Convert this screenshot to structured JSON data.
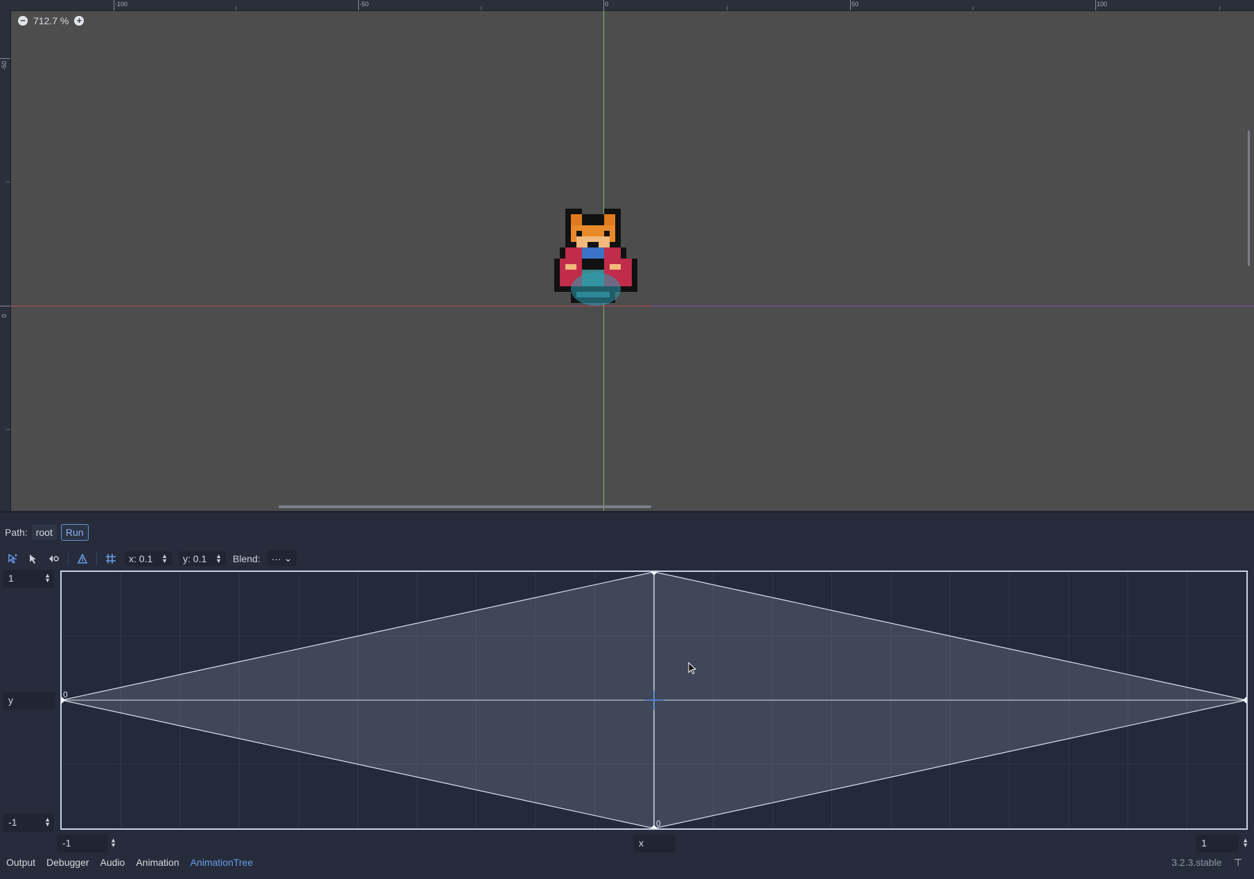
{
  "viewport": {
    "zoom_label": "712.7 %",
    "ruler_top_labels": [
      "-100",
      "-50",
      "0",
      "50",
      "100"
    ],
    "ruler_left_labels": [
      "-50",
      "0"
    ]
  },
  "path_bar": {
    "prefix": "Path:",
    "crumbs": [
      "root",
      "Run"
    ],
    "active_crumb": "Run"
  },
  "toolbar": {
    "snap_x": "x: 0.1",
    "snap_y": "y: 0.1",
    "blend_label": "Blend:",
    "blend_value": "···"
  },
  "blend_space": {
    "max_y": "1",
    "y_label": "y",
    "min_y": "-1",
    "min_x": "-1",
    "x_label": "x",
    "max_x": "1",
    "point_label_left": "0",
    "point_label_bottom": "0",
    "points": [
      {
        "x": -1,
        "y": 0
      },
      {
        "x": 0,
        "y": 1
      },
      {
        "x": 1,
        "y": 0
      },
      {
        "x": 0,
        "y": -1
      }
    ]
  },
  "bottom_tabs": {
    "items": [
      "Output",
      "Debugger",
      "Audio",
      "Animation",
      "AnimationTree"
    ],
    "active": "AnimationTree"
  },
  "version": "3.2.3.stable",
  "colors": {
    "accent": "#6a9be8",
    "axis_x": "#c0445c",
    "axis_y": "#7bbf5c",
    "viewport_bg": "#4d4d4d",
    "panel_bg": "#262c3b"
  }
}
